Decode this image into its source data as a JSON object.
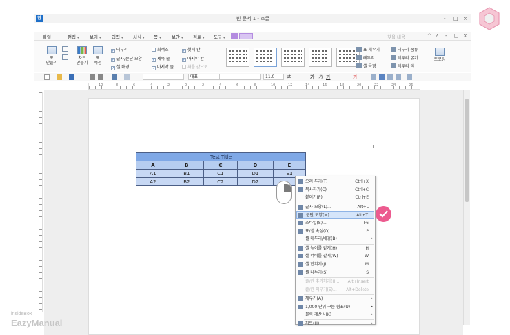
{
  "window": {
    "title": "빈 문서 1 - 호글",
    "app_icon": "한",
    "controls": [
      "-",
      "□",
      "×"
    ]
  },
  "menubar": {
    "items": [
      "파일",
      "편집",
      "보기",
      "입력",
      "서식",
      "쪽",
      "보안",
      "검토",
      "도구"
    ],
    "right_text": "찾을 내용",
    "right_controls": [
      "^",
      "?",
      "-",
      "□",
      "×"
    ]
  },
  "ribbon": {
    "table_btn": "표\n만들기",
    "chart_btn": "차트\n만들기",
    "props_btn": "표\n속성",
    "checks": [
      {
        "label": "테두리",
        "checked": true
      },
      {
        "label": "글자/문단 모양",
        "checked": true
      },
      {
        "label": "셀 배경",
        "checked": true
      },
      {
        "label": "회색조",
        "checked": false
      },
      {
        "label": "제목 줄",
        "checked": true
      },
      {
        "label": "마지막 줄",
        "checked": true
      },
      {
        "label": "첫째 칸",
        "checked": true
      },
      {
        "label": "마지막 칸",
        "checked": true
      },
      {
        "label": "처음 값으로",
        "checked": false
      }
    ],
    "right_tools": [
      "표 채우기",
      "테두리",
      "셀 음영",
      "테두리 종류",
      "테두리 굵기",
      "테두리 색"
    ],
    "last_btn": "트로팅"
  },
  "toolbar2": {
    "style": "대표",
    "font": "",
    "size": "11.0",
    "unit": "pt"
  },
  "ruler": {
    "numbers": [
      "10",
      "8",
      "6",
      "4",
      "2",
      "0",
      "2",
      "4",
      "6",
      "8",
      "10",
      "12",
      "14",
      "16",
      "18",
      "20",
      "22",
      "24",
      "26"
    ]
  },
  "table": {
    "title": "Test Title",
    "headers": [
      "A",
      "B",
      "C",
      "D",
      "E"
    ],
    "rows": [
      [
        "A1",
        "B1",
        "C1",
        "D1",
        "E1"
      ],
      [
        "A2",
        "B2",
        "C2",
        "D2",
        ""
      ]
    ]
  },
  "context_menu": {
    "items": [
      {
        "label": "오려 두기(T)",
        "key": "Ctrl+X",
        "icon": "scissors-icon"
      },
      {
        "label": "복사하기(C)",
        "key": "Ctrl+C",
        "icon": "copy-icon"
      },
      {
        "label": "붙이기(P)",
        "key": "Ctrl+E",
        "icon": ""
      },
      {
        "label": "글자 모양(L)...",
        "key": "Alt+L",
        "icon": "char-shape-icon"
      },
      {
        "label": "문단 모양(M)...",
        "key": "Alt+T",
        "icon": "para-shape-icon",
        "highlight": true
      },
      {
        "label": "스타일(S)...",
        "key": "F6",
        "icon": "style-icon"
      },
      {
        "label": "표/셀 속성(Q)...",
        "key": "P",
        "icon": "table-props-icon"
      },
      {
        "label": "셀 테두리/배경(B)",
        "key": "",
        "icon": "",
        "submenu": true
      },
      {
        "label": "셀 높이를 같게(H)",
        "key": "H",
        "icon": "row-height-icon"
      },
      {
        "label": "셀 너비를 같게(W)",
        "key": "W",
        "icon": "col-width-icon"
      },
      {
        "label": "셀 합치기(J)",
        "key": "M",
        "icon": "merge-icon"
      },
      {
        "label": "셀 나누기(S)",
        "key": "S",
        "icon": "split-icon"
      },
      {
        "label": "줄/칸 추가하기(I)...",
        "key": "Alt+Insert",
        "icon": "",
        "disabled": true
      },
      {
        "label": "줄/칸 지우기(E)...",
        "key": "Alt+Delete",
        "icon": "",
        "disabled": true
      },
      {
        "label": "채우기(A)",
        "key": "",
        "icon": "fill-icon",
        "submenu": true
      },
      {
        "label": "1,000 단위 구분 쉼표(U)",
        "key": "",
        "icon": "comma-icon",
        "submenu": true
      },
      {
        "label": "블록 계산식(K)",
        "key": "",
        "icon": "",
        "submenu": true
      },
      {
        "label": "차트(H)",
        "key": "",
        "icon": "chart-icon",
        "submenu": true
      }
    ]
  },
  "brand": {
    "line1": "insideBox",
    "line2": "EazyManual"
  },
  "colors": {
    "accent": "#ec5b8f",
    "table_title": "#7fa8e6",
    "menu_highlight": "#d5e5fa"
  }
}
